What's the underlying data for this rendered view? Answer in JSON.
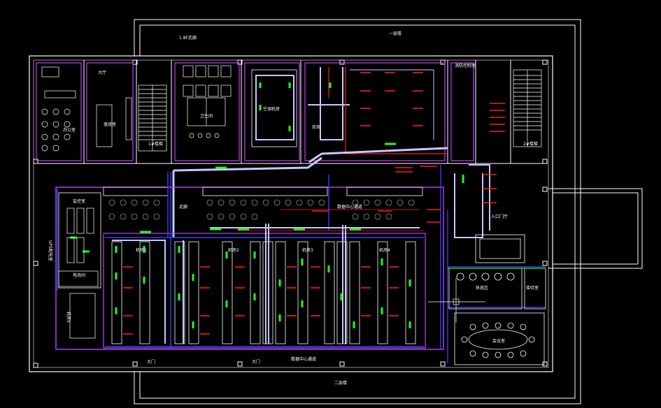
{
  "colors": {
    "background": "#000000",
    "wall": "#ffffff",
    "boundary": "#c040ff",
    "duct": "#c8c8ff",
    "blue": "#3040ff",
    "red": "#ff1a1a",
    "green": "#1aff1a",
    "grey": "#8c8c8c",
    "cyan": "#40ffff"
  },
  "labels": {
    "north_corridor": "1.8F走廊",
    "north_right": "一层楼",
    "bottom_center": "二层楼",
    "office": "办公室",
    "hall": "大厅",
    "duty_room": "值班室",
    "toilet": "卫生间",
    "corridor": "走廊",
    "entrance": "入口门厅",
    "meeting": "会议室",
    "lounge": "休息区",
    "reception": "接待室",
    "datacenter_corridor": "数据中心通道",
    "room1": "机房1",
    "room2": "机房2",
    "room3": "机房3",
    "room4": "机房4",
    "room5": "机房5",
    "ups_room": "UPS配电室",
    "battery_room": "电池间",
    "monitor_room": "监控室",
    "stair_1": "1#楼梯",
    "stair_2": "2#楼梯",
    "fire_room": "消防控制室",
    "air_room": "空调机房",
    "south_door1": "大门",
    "south_door2": "大门",
    "storage": "库房"
  }
}
